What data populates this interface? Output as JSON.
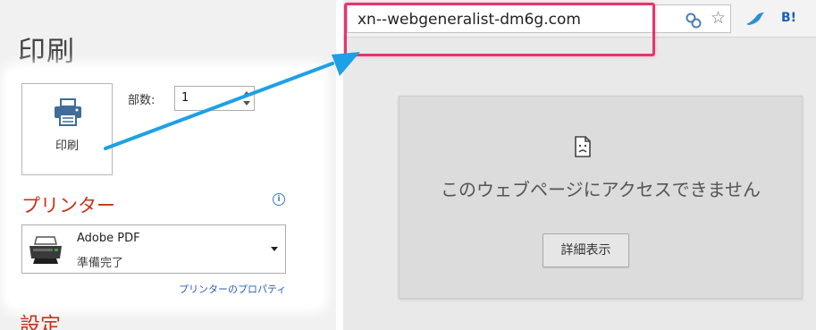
{
  "print_panel": {
    "title": "印刷",
    "print_button_label": "印刷",
    "copies_label": "部数:",
    "copies_value": "1",
    "printer_heading": "プリンター",
    "info_icon": "i",
    "printer_name": "Adobe PDF",
    "printer_status": "準備完了",
    "printer_properties_link": "プリンターのプロパティ",
    "settings_heading": "設定"
  },
  "browser": {
    "url": "xn--webgeneralist-dm6g.com",
    "hatena_bookmark_label": "B!",
    "error_message": "このウェブページにアクセスできません",
    "details_button_label": "詳細表示"
  },
  "icons": {
    "printer": "printer-icon",
    "pdf_printer": "printer-device-icon",
    "translate": "translate-icon",
    "bookmark_star": "bookmark-star-icon",
    "extension_bird": "bird-extension-icon",
    "sad_page": "sad-page-icon",
    "arrow": "annotation-arrow"
  },
  "colors": {
    "heading_red": "#c8321d",
    "link_blue": "#2a5fae",
    "url_highlight": "#e8336f",
    "arrow_blue": "#1ea0e6"
  }
}
